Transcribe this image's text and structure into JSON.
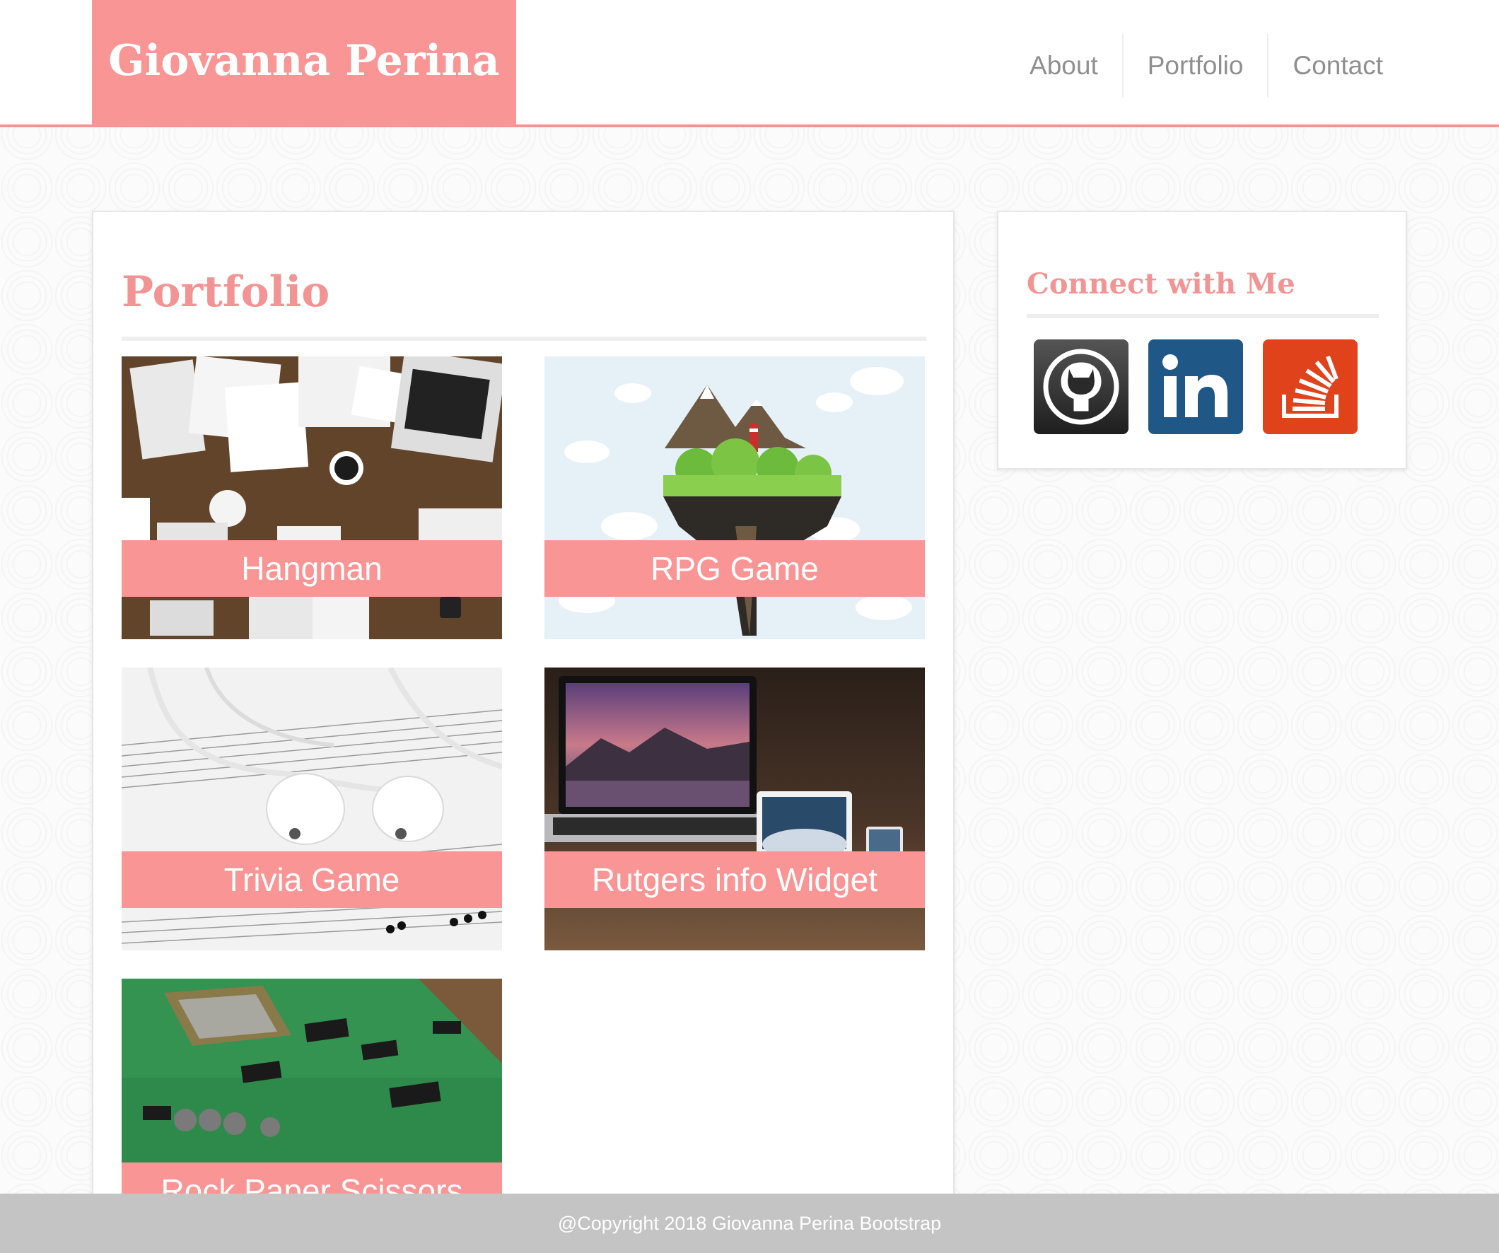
{
  "header": {
    "brand": "Giovanna Perina",
    "nav": [
      "About",
      "Portfolio",
      "Contact"
    ]
  },
  "main": {
    "title": "Portfolio",
    "projects": [
      {
        "label": "Hangman",
        "image": "desk-workspace"
      },
      {
        "label": "RPG Game",
        "image": "floating-island"
      },
      {
        "label": "Trivia Game",
        "image": "earbuds-sheet-music"
      },
      {
        "label": "Rutgers info Widget",
        "image": "laptop-tablet-phone"
      },
      {
        "label": "Rock Paper Scissors",
        "image": "circuit-board"
      }
    ]
  },
  "sidebar": {
    "title": "Connect with Me",
    "links": [
      {
        "name": "github-icon",
        "color": "#3a3a3a"
      },
      {
        "name": "linkedin-icon",
        "color": "#1f5887"
      },
      {
        "name": "stackoverflow-icon",
        "color": "#e0421c"
      }
    ]
  },
  "footer": {
    "copyright": "@Copyright 2018 Giovanna Perina Bootstrap"
  },
  "colors": {
    "accent": "#f99595",
    "heading": "#f39494",
    "nav_text": "#8f8f8f",
    "footer_bg": "#c4c4c4"
  }
}
